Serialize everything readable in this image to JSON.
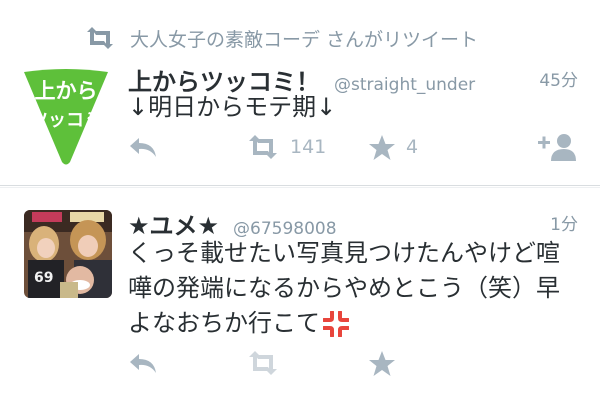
{
  "tweets": [
    {
      "retweeted_by_text": "大人女子の素敵コーデ さんがリツイート",
      "avatar_text_line1": "上から",
      "avatar_text_line2": "ツッコミ",
      "avatar_color": "#5ec03a",
      "name": "上からツッコミ！",
      "handle": "@straight_under",
      "time": "45分",
      "text": "↓明日からモテ期↓",
      "retweet_count": "141",
      "favorite_count": "4"
    },
    {
      "name": "★ユメ★",
      "handle": "@67598008",
      "time": "1分",
      "text_line1": "くっそ載せたい写真見つけたんやけど喧",
      "text_line2": "嘩の発端になるからやめとこう（笑）早",
      "text_line3": "よなおちか行こて",
      "anger_emoji": "💢",
      "anger_color": "#e8453c"
    }
  ],
  "colors": {
    "icon_gray": "#a8b6c1",
    "meta_gray": "#8899a6",
    "text": "#292f33"
  },
  "icons": [
    "retweet-icon",
    "reply-icon",
    "star-icon",
    "follow-icon"
  ]
}
